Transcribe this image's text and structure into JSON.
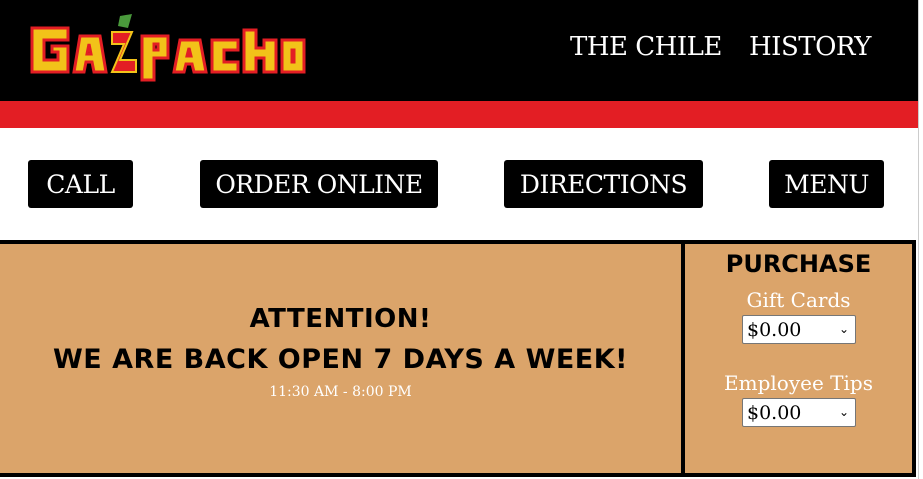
{
  "header": {
    "logo_text": "GAZPACHO",
    "nav": [
      {
        "label": "THE CHILE"
      },
      {
        "label": "HISTORY"
      }
    ]
  },
  "actions": {
    "call": "CALL",
    "order_online": "ORDER ONLINE",
    "directions": "DIRECTIONS",
    "menu": "MENU"
  },
  "attention": {
    "line1": "ATTENTION!",
    "line2": "WE ARE BACK OPEN 7 DAYS A WEEK!",
    "hours": "11:30 AM - 8:00 PM"
  },
  "purchase": {
    "title": "PURCHASE",
    "gift_cards_label": "Gift Cards",
    "gift_cards_value": "$0.00",
    "tips_label": "Employee Tips",
    "tips_value": "$0.00"
  },
  "colors": {
    "header_bg": "#000000",
    "accent_red": "#e31e24",
    "panel_tan": "#dba46a",
    "logo_yellow": "#f2c319",
    "logo_red": "#e31e24",
    "logo_green": "#4a9a3c"
  }
}
